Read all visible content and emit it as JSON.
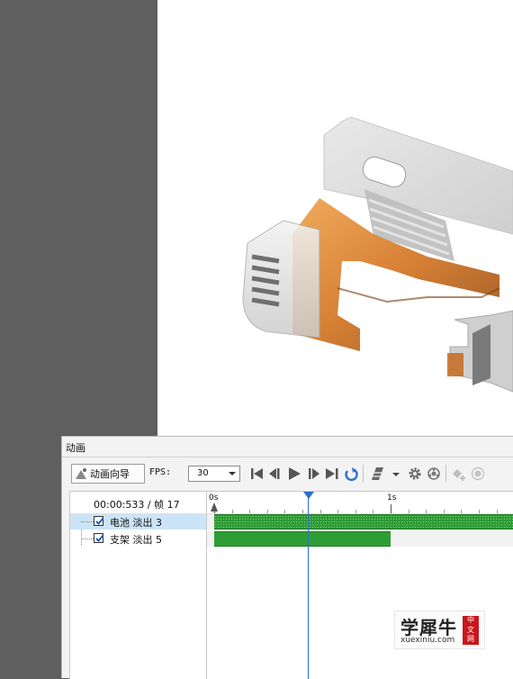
{
  "viewport": {
    "label": "3d-model-view"
  },
  "panel": {
    "title": "动画"
  },
  "toolbar": {
    "wizard_label": "动画向导",
    "fps_label": "FPS:",
    "fps_value": "30",
    "icons": [
      "skip-to-start-icon",
      "step-back-icon",
      "play-icon",
      "step-forward-icon",
      "skip-to-end-icon",
      "loop-icon",
      "keyframe-tool-icon",
      "dropdown-arrow-icon",
      "settings-icon",
      "camera-settings-icon",
      "add-key-icon",
      "record-icon"
    ]
  },
  "timeline": {
    "time_readout": "00:00:533 / 帧 17",
    "ruler": [
      {
        "label": "0s",
        "seconds": 0
      },
      {
        "label": "1s",
        "seconds": 1
      }
    ],
    "playhead_seconds": 0.533,
    "rows": [
      {
        "label": "电池 淡出 3",
        "checked": true,
        "selected": true,
        "start": 0,
        "end": 1.8,
        "style": "dotted"
      },
      {
        "label": "支架 淡出 5",
        "checked": true,
        "selected": false,
        "start": 0,
        "end": 1.0,
        "style": "solid"
      }
    ]
  },
  "watermark": {
    "main": "学犀牛",
    "sub": "xuexiniu.com",
    "seal": [
      "中",
      "文",
      "网"
    ]
  },
  "colors": {
    "accent_blue": "#2b6fcf",
    "track_green": "#2e9e34",
    "selection": "#cce4f7",
    "viewport_bg": "#ffffff",
    "outer_bg": "#5f5f5f"
  }
}
